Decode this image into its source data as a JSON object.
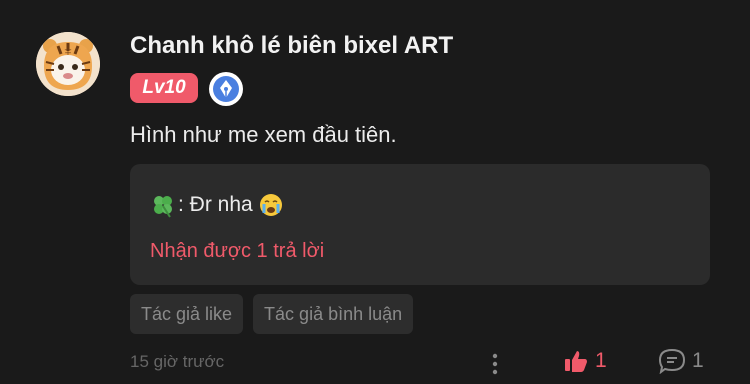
{
  "comment": {
    "user": {
      "name": "Chanh khô lé biên bixel ART",
      "level": "Lv10"
    },
    "text": "Hình như me xem đầu tiên.",
    "reply_preview": {
      "text": ": Đr nha",
      "reply_count_label": "Nhận được 1 trả lời"
    },
    "tags": [
      "Tác giả like",
      "Tác giả bình luận"
    ],
    "timestamp": "15 giờ trước",
    "likes": "1",
    "comments": "1"
  },
  "colors": {
    "background": "#1a1a1a",
    "accent": "#f05a6a",
    "reply_box": "#2b2b2b",
    "tag_bg": "#2d2d2d",
    "muted": "#8a8a8a",
    "creator_badge": "#4a7fe0"
  },
  "icons": {
    "avatar": "tiger-avatar",
    "creator_badge": "pen-nib-icon",
    "reply_prefix": "clover-icon",
    "reply_emoji": "crying-face-icon",
    "more": "more-vertical-icon",
    "like": "thumbs-up-icon",
    "comment": "comment-bubble-icon"
  }
}
